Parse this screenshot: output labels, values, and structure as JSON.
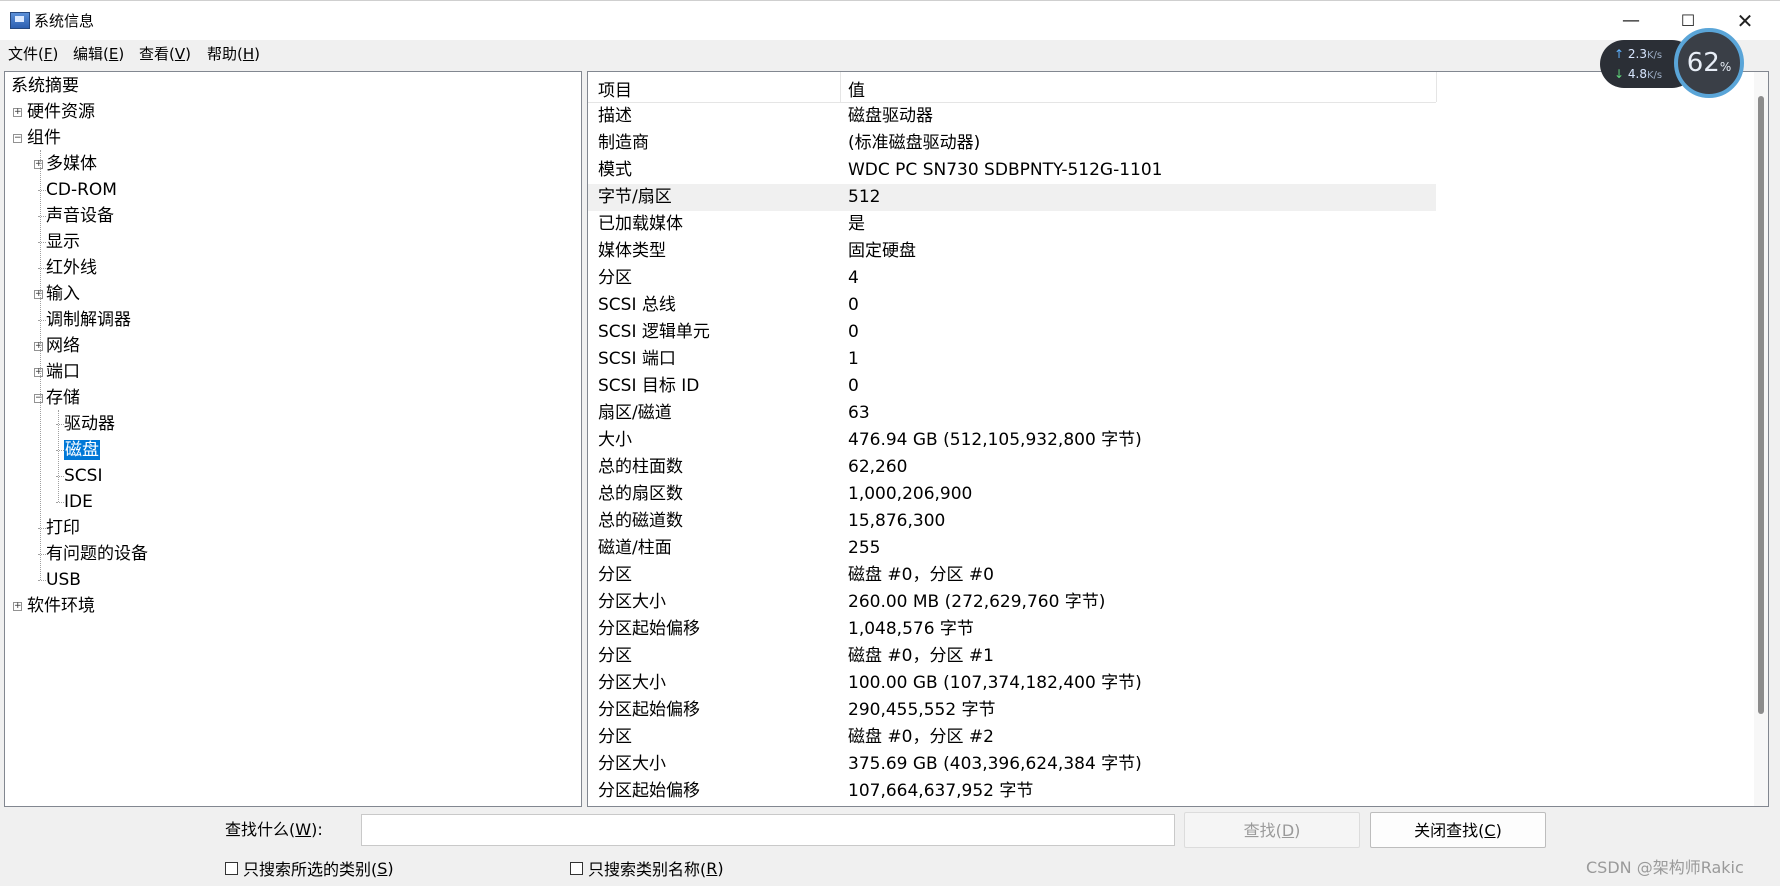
{
  "window": {
    "title": "系统信息",
    "controls": {
      "minimize": "—",
      "maximize": "☐",
      "close": "✕"
    }
  },
  "menu": [
    {
      "label": "文件(",
      "key": "F",
      "suffix": ")"
    },
    {
      "label": "编辑(",
      "key": "E",
      "suffix": ")"
    },
    {
      "label": "查看(",
      "key": "V",
      "suffix": ")"
    },
    {
      "label": "帮助(",
      "key": "H",
      "suffix": ")"
    }
  ],
  "tree": [
    {
      "label": "系统摘要",
      "level": 0,
      "expander": ""
    },
    {
      "label": "硬件资源",
      "level": 0,
      "expander": "+"
    },
    {
      "label": "组件",
      "level": 0,
      "expander": "−"
    },
    {
      "label": "多媒体",
      "level": 1,
      "expander": "+"
    },
    {
      "label": "CD-ROM",
      "level": 1,
      "expander": ""
    },
    {
      "label": "声音设备",
      "level": 1,
      "expander": ""
    },
    {
      "label": "显示",
      "level": 1,
      "expander": ""
    },
    {
      "label": "红外线",
      "level": 1,
      "expander": ""
    },
    {
      "label": "输入",
      "level": 1,
      "expander": "+"
    },
    {
      "label": "调制解调器",
      "level": 1,
      "expander": ""
    },
    {
      "label": "网络",
      "level": 1,
      "expander": "+"
    },
    {
      "label": "端口",
      "level": 1,
      "expander": "+"
    },
    {
      "label": "存储",
      "level": 1,
      "expander": "−"
    },
    {
      "label": "驱动器",
      "level": 2,
      "expander": ""
    },
    {
      "label": "磁盘",
      "level": 2,
      "expander": "",
      "selected": true
    },
    {
      "label": "SCSI",
      "level": 2,
      "expander": ""
    },
    {
      "label": "IDE",
      "level": 2,
      "expander": ""
    },
    {
      "label": "打印",
      "level": 1,
      "expander": ""
    },
    {
      "label": "有问题的设备",
      "level": 1,
      "expander": ""
    },
    {
      "label": "USB",
      "level": 1,
      "expander": ""
    },
    {
      "label": "软件环境",
      "level": 0,
      "expander": "+"
    }
  ],
  "list": {
    "headers": {
      "name": "项目",
      "value": "值"
    },
    "rows": [
      {
        "name": "描述",
        "value": "磁盘驱动器"
      },
      {
        "name": "制造商",
        "value": "(标准磁盘驱动器)"
      },
      {
        "name": "模式",
        "value": "WDC PC SN730 SDBPNTY-512G-1101"
      },
      {
        "name": "字节/扇区",
        "value": "512",
        "highlight": true
      },
      {
        "name": "已加载媒体",
        "value": "是"
      },
      {
        "name": "媒体类型",
        "value": "固定硬盘"
      },
      {
        "name": "分区",
        "value": "4"
      },
      {
        "name": "SCSI 总线",
        "value": "0"
      },
      {
        "name": "SCSI 逻辑单元",
        "value": "0"
      },
      {
        "name": "SCSI 端口",
        "value": "1"
      },
      {
        "name": "SCSI 目标 ID",
        "value": "0"
      },
      {
        "name": "扇区/磁道",
        "value": "63"
      },
      {
        "name": "大小",
        "value": "476.94 GB (512,105,932,800 字节)"
      },
      {
        "name": "总的柱面数",
        "value": "62,260"
      },
      {
        "name": "总的扇区数",
        "value": "1,000,206,900"
      },
      {
        "name": "总的磁道数",
        "value": "15,876,300"
      },
      {
        "name": "磁道/柱面",
        "value": "255"
      },
      {
        "name": "分区",
        "value": "磁盘 #0，分区 #0"
      },
      {
        "name": "分区大小",
        "value": "260.00 MB (272,629,760 字节)"
      },
      {
        "name": "分区起始偏移",
        "value": "1,048,576 字节"
      },
      {
        "name": "分区",
        "value": "磁盘 #0，分区 #1"
      },
      {
        "name": "分区大小",
        "value": "100.00 GB (107,374,182,400 字节)"
      },
      {
        "name": "分区起始偏移",
        "value": "290,455,552 字节"
      },
      {
        "name": "分区",
        "value": "磁盘 #0，分区 #2"
      },
      {
        "name": "分区大小",
        "value": "375.69 GB (403,396,624,384 字节)"
      },
      {
        "name": "分区起始偏移",
        "value": "107,664,637,952 字节"
      }
    ]
  },
  "find": {
    "label_prefix": "查找什么(",
    "label_key": "W",
    "label_suffix": "):",
    "input_value": "",
    "find_button": {
      "prefix": "查找(",
      "key": "D",
      "suffix": ")"
    },
    "close_button": {
      "prefix": "关闭查找(",
      "key": "C",
      "suffix": ")"
    },
    "check_selected": {
      "prefix": "只搜索所选的类别(",
      "key": "S",
      "suffix": ")"
    },
    "check_names": {
      "prefix": "只搜索类别名称(",
      "key": "R",
      "suffix": ")"
    }
  },
  "net_widget": {
    "up": "2.3",
    "down": "4.8",
    "unit": "K/s",
    "percent": "62",
    "percent_unit": "%"
  },
  "watermark": "CSDN @架构师Rakic",
  "colors": {
    "selection": "#0078d7",
    "row_highlight": "#f0f0f0"
  }
}
